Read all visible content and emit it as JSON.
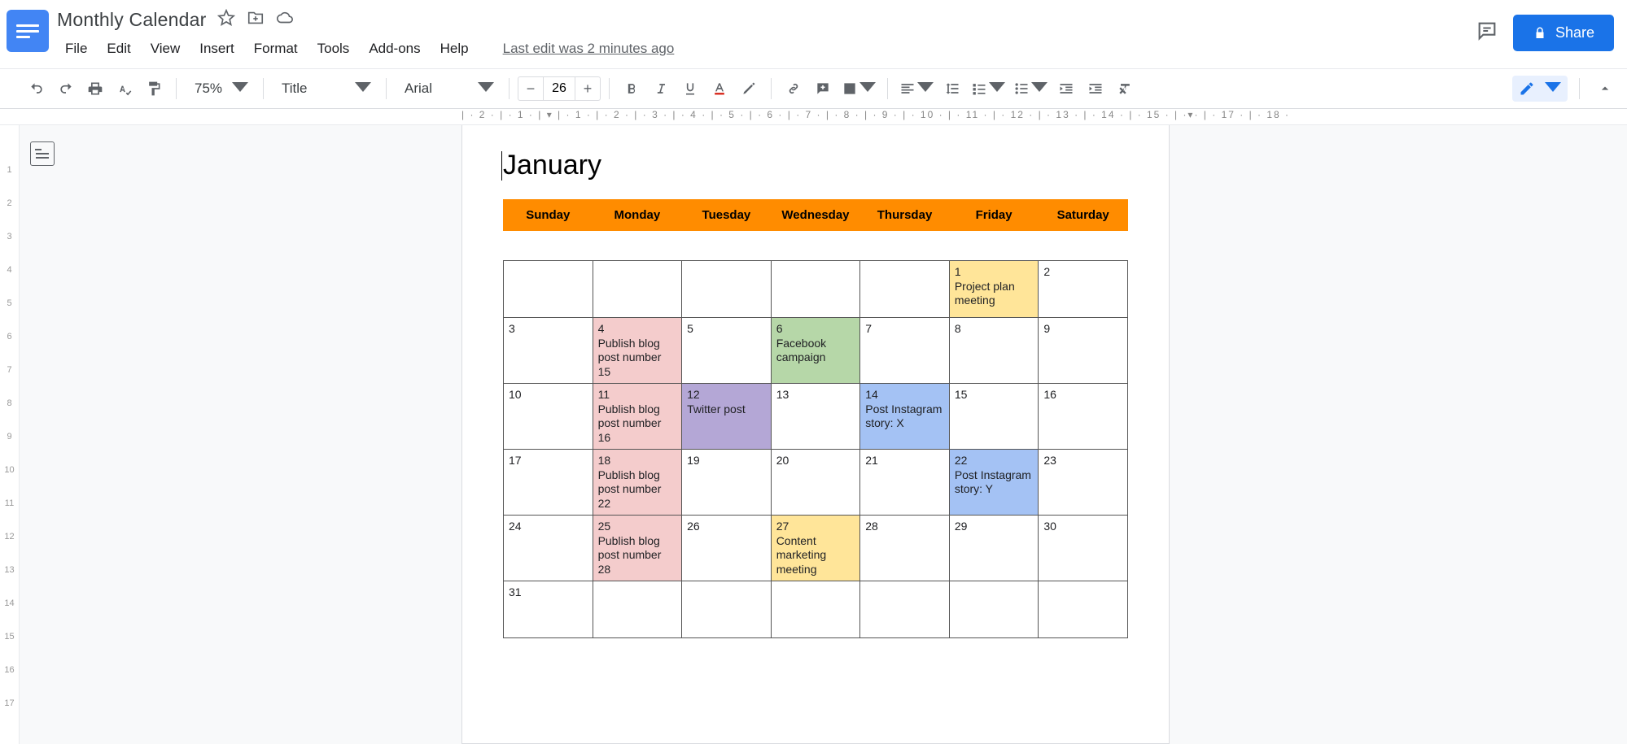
{
  "doc": {
    "title": "Monthly Calendar",
    "last_edit": "Last edit was 2 minutes ago"
  },
  "menu": [
    "File",
    "Edit",
    "View",
    "Insert",
    "Format",
    "Tools",
    "Add-ons",
    "Help"
  ],
  "toolbar": {
    "zoom": "75%",
    "style": "Title",
    "font": "Arial",
    "fontsize": "26"
  },
  "share_label": "Share",
  "ruler_h": "| · 2 · | · 1 · | ▾ | · 1 · | · 2 · | · 3 · | · 4 · | · 5 · | · 6 · | · 7 · | · 8 · | · 9 · | · 10 · | · 11 · | · 12 · | · 13 · | · 14 · | · 15 · | ·▾· | · 17 · | · 18 ·",
  "ruler_v": [
    "",
    "1",
    "2",
    "3",
    "4",
    "5",
    "6",
    "7",
    "8",
    "9",
    "10",
    "11",
    "12",
    "13",
    "14",
    "15",
    "16",
    "17"
  ],
  "calendar": {
    "month": "January",
    "days": [
      "Sunday",
      "Monday",
      "Tuesday",
      "Wednesday",
      "Thursday",
      "Friday",
      "Saturday"
    ],
    "weeks": [
      [
        {
          "num": "",
          "text": "",
          "color": ""
        },
        {
          "num": "",
          "text": "",
          "color": ""
        },
        {
          "num": "",
          "text": "",
          "color": ""
        },
        {
          "num": "",
          "text": "",
          "color": ""
        },
        {
          "num": "",
          "text": "",
          "color": ""
        },
        {
          "num": "1",
          "text": "Project plan meeting",
          "color": "yellow"
        },
        {
          "num": "2",
          "text": "",
          "color": ""
        }
      ],
      [
        {
          "num": "3",
          "text": "",
          "color": ""
        },
        {
          "num": "4",
          "text": "Publish blog post number 15",
          "color": "pink"
        },
        {
          "num": "5",
          "text": "",
          "color": ""
        },
        {
          "num": "6",
          "text": "Facebook campaign",
          "color": "green"
        },
        {
          "num": "7",
          "text": "",
          "color": ""
        },
        {
          "num": "8",
          "text": "",
          "color": ""
        },
        {
          "num": "9",
          "text": "",
          "color": ""
        }
      ],
      [
        {
          "num": "10",
          "text": "",
          "color": ""
        },
        {
          "num": "11",
          "text": "Publish blog post number 16",
          "color": "pink"
        },
        {
          "num": "12",
          "text": "Twitter post",
          "color": "purple"
        },
        {
          "num": "13",
          "text": "",
          "color": ""
        },
        {
          "num": "14",
          "text": "Post Instagram story: X",
          "color": "blue"
        },
        {
          "num": "15",
          "text": "",
          "color": ""
        },
        {
          "num": "16",
          "text": "",
          "color": ""
        }
      ],
      [
        {
          "num": "17",
          "text": "",
          "color": ""
        },
        {
          "num": "18",
          "text": "Publish blog post number 22",
          "color": "pink"
        },
        {
          "num": "19",
          "text": "",
          "color": ""
        },
        {
          "num": "20",
          "text": "",
          "color": ""
        },
        {
          "num": "21",
          "text": "",
          "color": ""
        },
        {
          "num": "22",
          "text": "Post Instagram story: Y",
          "color": "blue"
        },
        {
          "num": "23",
          "text": "",
          "color": ""
        }
      ],
      [
        {
          "num": "24",
          "text": "",
          "color": ""
        },
        {
          "num": "25",
          "text": "Publish blog post number 28",
          "color": "pink"
        },
        {
          "num": "26",
          "text": "",
          "color": ""
        },
        {
          "num": "27",
          "text": "Content marketing meeting",
          "color": "yellow"
        },
        {
          "num": "28",
          "text": "",
          "color": ""
        },
        {
          "num": "29",
          "text": "",
          "color": ""
        },
        {
          "num": "30",
          "text": "",
          "color": ""
        }
      ],
      [
        {
          "num": "31",
          "text": "",
          "color": ""
        },
        {
          "num": "",
          "text": "",
          "color": ""
        },
        {
          "num": "",
          "text": "",
          "color": ""
        },
        {
          "num": "",
          "text": "",
          "color": ""
        },
        {
          "num": "",
          "text": "",
          "color": ""
        },
        {
          "num": "",
          "text": "",
          "color": ""
        },
        {
          "num": "",
          "text": "",
          "color": ""
        }
      ]
    ]
  }
}
